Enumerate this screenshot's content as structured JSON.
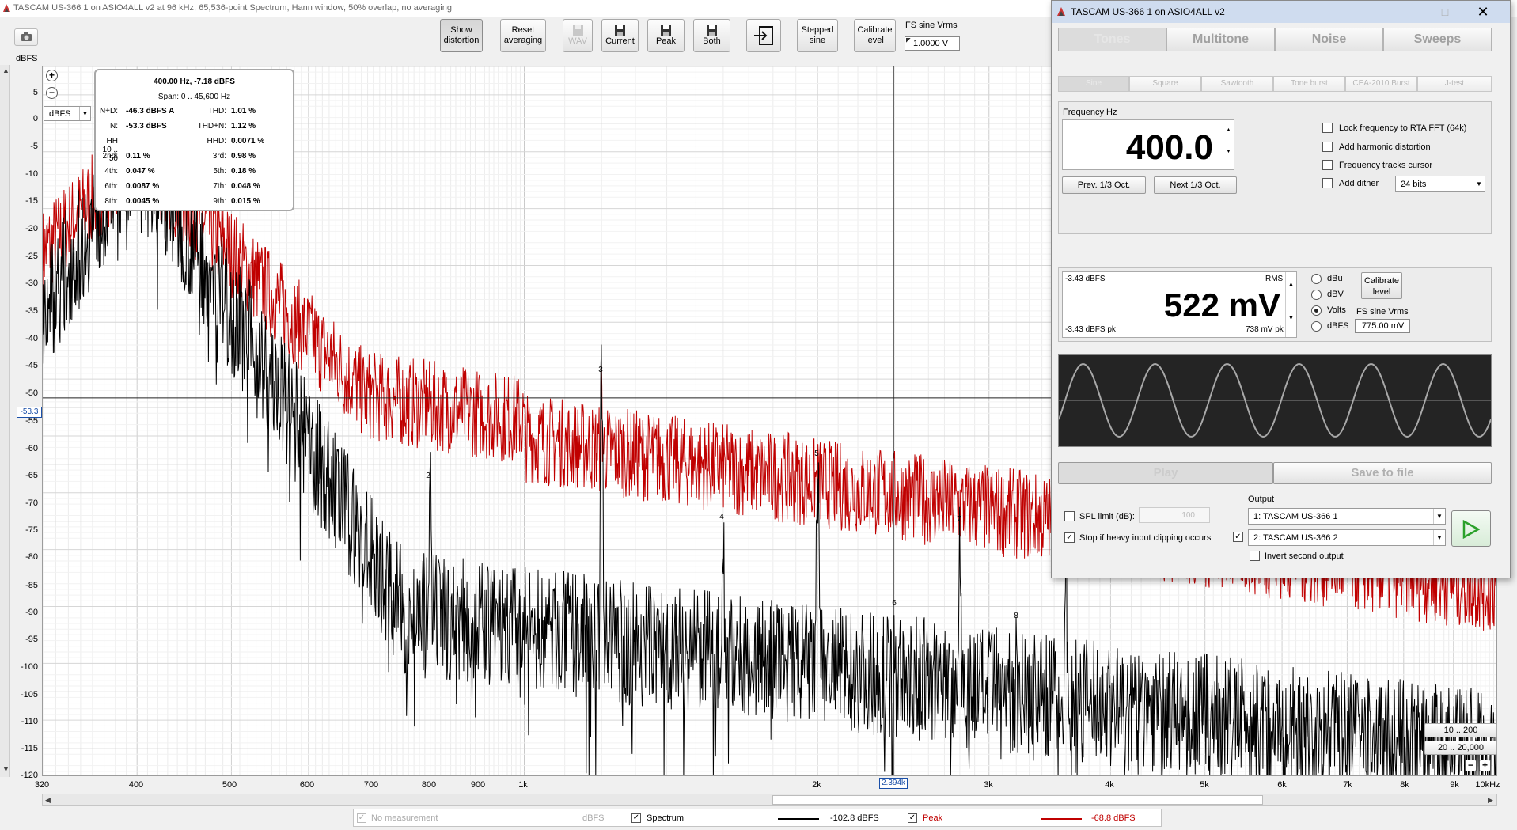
{
  "titlebar": {
    "title": "TASCAM US-366 1 on ASIO4ALL v2 at 96 kHz, 65,536-point Spectrum, Hann window, 50% overlap, no averaging"
  },
  "toolbar": {
    "show_distortion": [
      "Show",
      "distortion"
    ],
    "reset_averaging": [
      "Reset",
      "averaging"
    ],
    "wav": "WAV",
    "current": "Current",
    "peak": "Peak",
    "both": "Both",
    "stepped_sine": [
      "Stepped",
      "sine"
    ],
    "calibrate_level": [
      "Calibrate",
      "level"
    ],
    "fs_sine_label": "FS sine Vrms",
    "fs_sine_value": "1.0000 V"
  },
  "graph": {
    "y_unit": "dBFS",
    "unit_select": "dBFS",
    "cursor_db": "-53.3",
    "cursor_freq": "2.394k",
    "y_ticks": [
      "5",
      "0",
      "-5",
      "-10",
      "-15",
      "-20",
      "-25",
      "-30",
      "-35",
      "-40",
      "-45",
      "-50",
      "-55",
      "-60",
      "-65",
      "-70",
      "-75",
      "-80",
      "-85",
      "-90",
      "-95",
      "-100",
      "-105",
      "-110",
      "-115",
      "-120"
    ],
    "x_ticks": [
      "320",
      "400",
      "500",
      "600",
      "700",
      "800",
      "900",
      "1k",
      "2k",
      "3k",
      "4k",
      "5k",
      "6k",
      "7k",
      "8k",
      "9k",
      "10kHz"
    ],
    "harmonic_labels": [
      "2",
      "3",
      "4",
      "5",
      "6",
      "7",
      "8"
    ],
    "range_buttons": [
      "10 .. 200",
      "20 .. 20,000"
    ]
  },
  "info": {
    "title": "400.00 Hz, -7.18 dBFS",
    "span": "Span: 0 .. 45,600 Hz",
    "rows": [
      {
        "l1": "N+D:",
        "v1": "-46.3 dBFS A",
        "l2": "THD:",
        "v2": "1.01 %"
      },
      {
        "l1": "N:",
        "v1": "-53.3 dBFS",
        "l2": "THD+N:",
        "v2": "1.12 %"
      },
      {
        "l1": "HH 10 .. 50",
        "v1": "",
        "l2": "HHD:",
        "v2": "0.0071 %"
      },
      {
        "l1": "2nd:",
        "v1": "0.11 %",
        "l2": "3rd:",
        "v2": "0.98 %"
      },
      {
        "l1": "4th:",
        "v1": "0.047 %",
        "l2": "5th:",
        "v2": "0.18 %"
      },
      {
        "l1": "6th:",
        "v1": "0.0087 %",
        "l2": "7th:",
        "v2": "0.048 %"
      },
      {
        "l1": "8th:",
        "v1": "0.0045 %",
        "l2": "9th:",
        "v2": "0.015 %"
      }
    ]
  },
  "legend": {
    "no_measurement": "No measurement",
    "no_measurement_unit": "dBFS",
    "spectrum": "Spectrum",
    "spectrum_value": "-102.8 dBFS",
    "peak": "Peak",
    "peak_value": "-68.8 dBFS",
    "spectrum_color": "#000000",
    "peak_color": "#c00000"
  },
  "generator": {
    "title": "TASCAM US-366 1 on ASIO4ALL v2",
    "tabs": [
      "Tones",
      "Multitone",
      "Noise",
      "Sweeps"
    ],
    "subtabs": [
      "Sine",
      "Square",
      "Sawtooth",
      "Tone burst",
      "CEA-2010 Burst",
      "J-test"
    ],
    "freq_label": "Frequency Hz",
    "freq_value": "400.0",
    "prev_oct": "Prev. 1/3 Oct.",
    "next_oct": "Next 1/3 Oct.",
    "options": [
      "Lock frequency to RTA FFT (64k)",
      "Add harmonic distortion",
      "Frequency tracks cursor",
      "Add dither"
    ],
    "dither_bits": "24 bits",
    "level_rms_dbfs": "-3.43 dBFS",
    "level_rms": "RMS",
    "level_value": "522 mV",
    "level_pk_dbfs": "-3.43 dBFS pk",
    "level_pk": "738 mV pk",
    "units": [
      "dBu",
      "dBV",
      "Volts",
      "dBFS"
    ],
    "calibrate": [
      "Calibrate",
      "level"
    ],
    "fs_label": "FS sine Vrms",
    "fs_value": "775.00 mV",
    "play": "Play",
    "save": "Save to file",
    "spl_limit": "SPL limit (dB):",
    "spl_value": "100",
    "stop_clip": "Stop if heavy input clipping occurs",
    "output_label": "Output",
    "output1": "1: TASCAM US-366 1",
    "output2": "2: TASCAM US-366 2",
    "invert": "Invert second output"
  }
}
